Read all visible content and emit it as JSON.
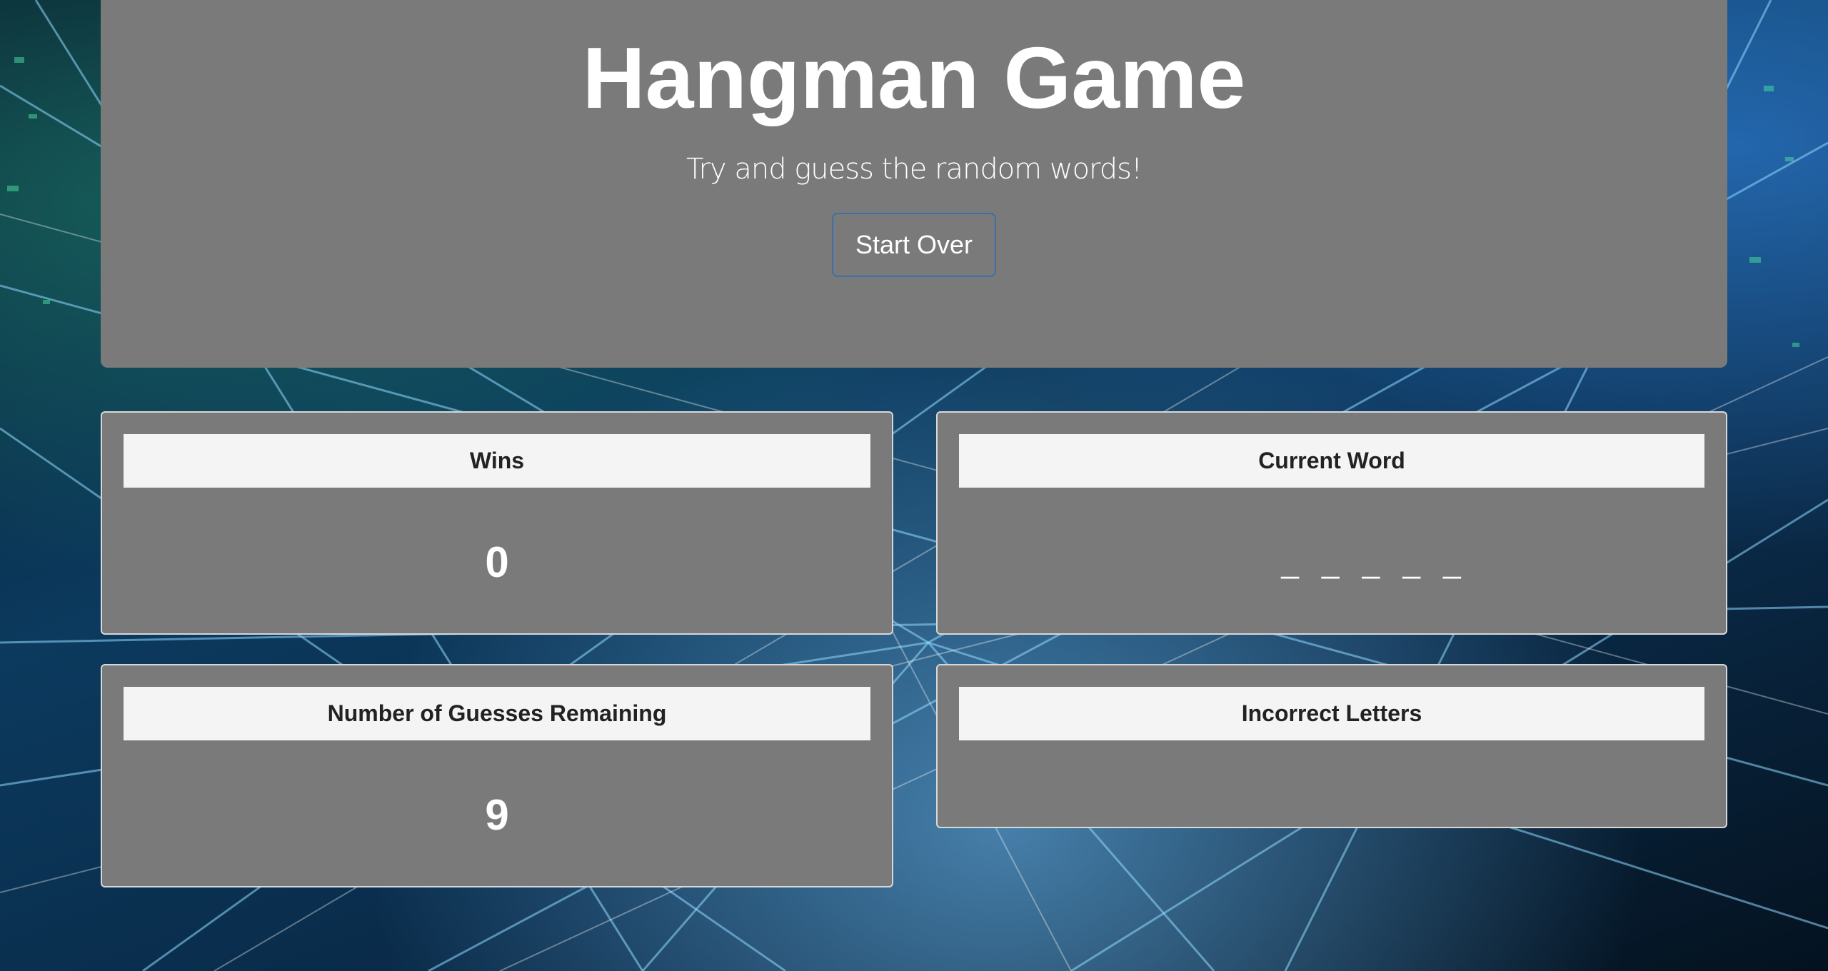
{
  "header": {
    "title": "Hangman Game",
    "subtitle": "Try and guess the random words!",
    "start_over_label": "Start Over"
  },
  "panels": {
    "wins": {
      "heading": "Wins",
      "value": "0"
    },
    "current_word": {
      "heading": "Current Word",
      "value": "_ _ _ _ _"
    },
    "guesses_remaining": {
      "heading": "Number of Guesses Remaining",
      "value": "9"
    },
    "incorrect_letters": {
      "heading": "Incorrect Letters",
      "value": ""
    }
  },
  "colors": {
    "panel_background": "#7a7a7a",
    "panel_heading_background": "#f4f4f4",
    "button_border": "#3d6fa8",
    "text_light": "#ffffff",
    "text_dark": "#222222"
  }
}
